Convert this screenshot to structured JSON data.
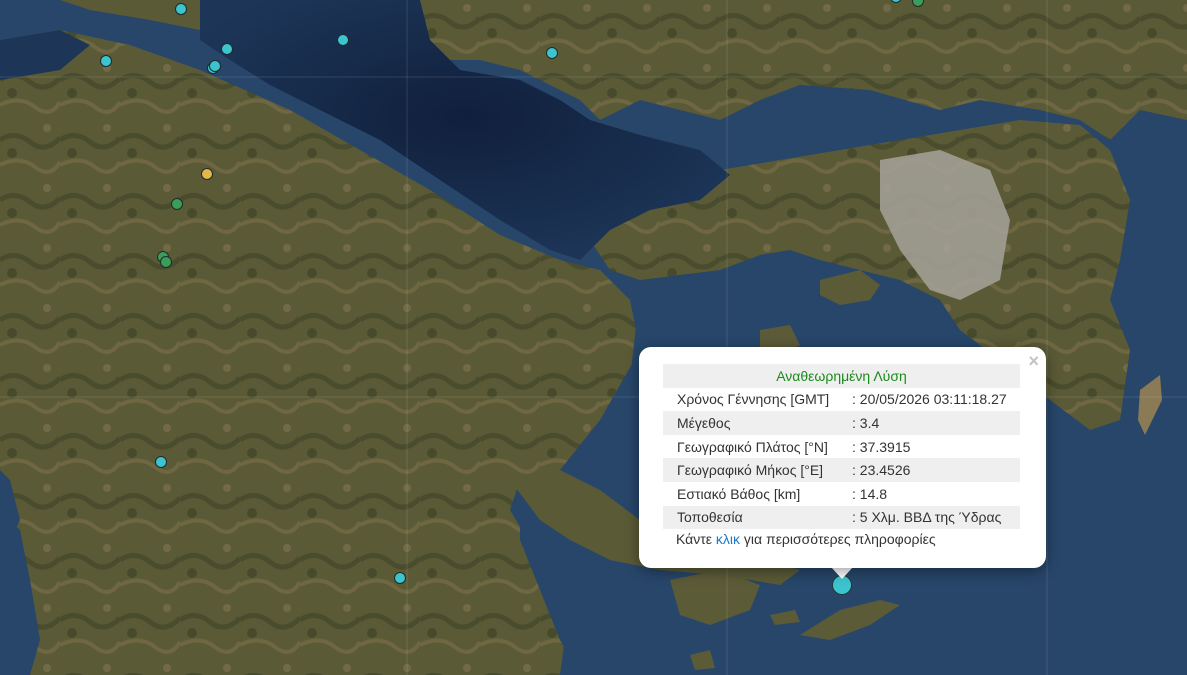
{
  "map": {
    "style": "satellite",
    "colors": {
      "sea_deep": "#142a4a",
      "sea": "#2a4667",
      "land": "#5c5b38",
      "land_dark": "#394024",
      "land_light": "#8a7a55",
      "urban": "#a6a39a"
    },
    "markers": [
      {
        "color": "#3cc4cf",
        "size": "small"
      },
      {
        "color": "#3cc4cf",
        "size": "small"
      },
      {
        "color": "#3cc4cf",
        "size": "small"
      },
      {
        "color": "#3cc4cf",
        "size": "small"
      },
      {
        "color": "#3cc4cf",
        "size": "small"
      },
      {
        "color": "#3cc4cf",
        "size": "small"
      },
      {
        "color": "#3cc4cf",
        "size": "small"
      },
      {
        "color": "#3a9d5a",
        "size": "small"
      },
      {
        "color": "#3cc4cf",
        "size": "small"
      },
      {
        "color": "#e2b84a",
        "size": "small"
      },
      {
        "color": "#3a9d5a",
        "size": "small"
      },
      {
        "color": "#3a9d5a",
        "size": "small"
      },
      {
        "color": "#3a9d5a",
        "size": "small"
      },
      {
        "color": "#3cc4cf",
        "size": "small"
      },
      {
        "color": "#3cc4cf",
        "size": "small"
      },
      {
        "color": "#3cc4cf",
        "size": "large",
        "selected": true
      }
    ]
  },
  "popup": {
    "title": "Αναθεωρημένη Λύση",
    "close_icon": "×",
    "rows": [
      {
        "label": "Χρόνος Γέννησης [GMT]",
        "value": ": 20/05/2026 03:11:18.27"
      },
      {
        "label": "Μέγεθος",
        "value": ": 3.4"
      },
      {
        "label": "Γεωγραφικό Πλάτος [°N]",
        "value": ": 37.3915"
      },
      {
        "label": "Γεωγραφικό Μήκος [°E]",
        "value": ": 23.4526"
      },
      {
        "label": "Εστιακό Βάθος [km]",
        "value": ": 14.8"
      },
      {
        "label": "Τοποθεσία",
        "value": ": 5 Χλμ. ΒΒΔ της Ύδρας"
      }
    ],
    "more_prefix": "Κάντε ",
    "more_link": "κλικ",
    "more_suffix": " για περισσότερες πληροφορίες"
  }
}
